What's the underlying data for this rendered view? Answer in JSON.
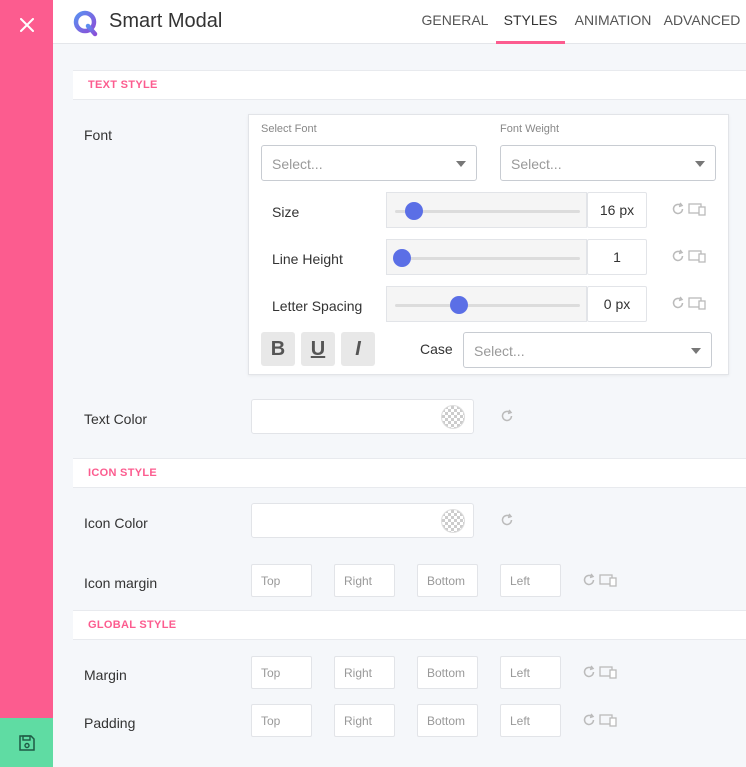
{
  "app": {
    "title": "Smart Modal"
  },
  "tabs": [
    {
      "label": "GENERAL",
      "active": false
    },
    {
      "label": "STYLES",
      "active": true
    },
    {
      "label": "ANIMATION",
      "active": false
    },
    {
      "label": "ADVANCED",
      "active": false
    }
  ],
  "sections": {
    "text_style": "TEXT STYLE",
    "icon_style": "ICON STYLE",
    "global_style": "GLOBAL STYLE"
  },
  "font": {
    "label": "Font",
    "select_font_label": "Select Font",
    "select_font_placeholder": "Select...",
    "font_weight_label": "Font Weight",
    "font_weight_placeholder": "Select...",
    "size": {
      "label": "Size",
      "value": "16 px",
      "slider_fraction": 0.12
    },
    "line_height": {
      "label": "Line Height",
      "value": "1",
      "slider_fraction": 0.0
    },
    "letter_spacing": {
      "label": "Letter Spacing",
      "value": "0 px",
      "slider_fraction": 0.35
    },
    "bold": "B",
    "underline": "U",
    "italic": "I",
    "case_label": "Case",
    "case_placeholder": "Select..."
  },
  "text_color": {
    "label": "Text Color"
  },
  "icon_color": {
    "label": "Icon Color"
  },
  "icon_margin": {
    "label": "Icon margin",
    "top": "Top",
    "right": "Right",
    "bottom": "Bottom",
    "left": "Left"
  },
  "margin": {
    "label": "Margin",
    "top": "Top",
    "right": "Right",
    "bottom": "Bottom",
    "left": "Left"
  },
  "padding": {
    "label": "Padding",
    "top": "Top",
    "right": "Right",
    "bottom": "Bottom",
    "left": "Left"
  },
  "colors": {
    "accent": "#fc5c8f",
    "save": "#5fdca3",
    "slider": "#5b6fe6"
  },
  "icons": {
    "close": "close-icon",
    "save": "floppy-disk-icon",
    "reset": "reset-icon",
    "responsive": "responsive-device-icon"
  }
}
